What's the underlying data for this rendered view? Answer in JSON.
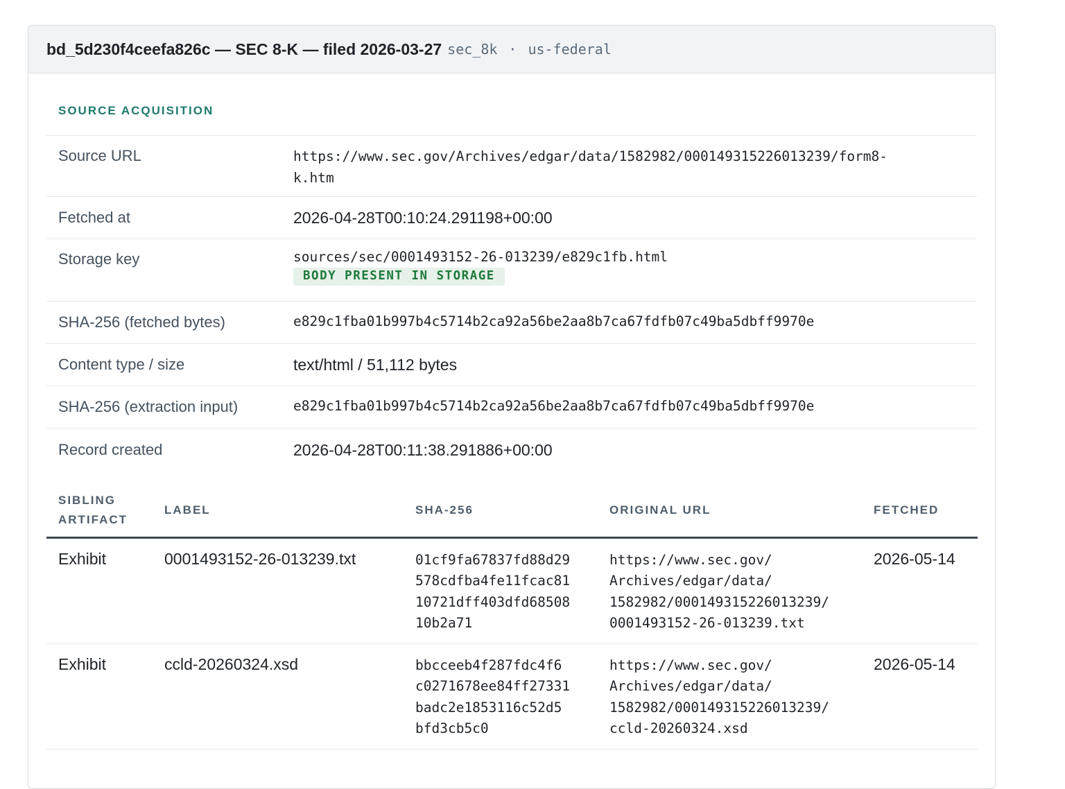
{
  "header": {
    "title": "bd_5d230f4ceefa826c — SEC 8-K — filed 2026-03-27",
    "tag1": "sec_8k",
    "separator": "·",
    "tag2": "us-federal"
  },
  "source": {
    "section_title": "SOURCE ACQUISITION",
    "rows": [
      {
        "label": "Source URL",
        "value_line1": "https://www.sec.gov/Archives/edgar/data/1582982/000149315226013239/form8-",
        "value_line2": "k.htm"
      },
      {
        "label": "Fetched at",
        "value": "2026-04-28T00:10:24.291198+00:00"
      },
      {
        "label": "Storage key",
        "value": "sources/sec/0001493152-26-013239/e829c1fb.html",
        "badge": "BODY PRESENT IN STORAGE"
      },
      {
        "label": "SHA-256 (fetched bytes)",
        "value": "e829c1fba01b997b4c5714b2ca92a56be2aa8b7ca67fdfb07c49ba5dbff9970e"
      },
      {
        "label": "Content type / size",
        "value": "text/html / 51,112 bytes"
      },
      {
        "label": "SHA-256 (extraction input)",
        "value": "e829c1fba01b997b4c5714b2ca92a56be2aa8b7ca67fdfb07c49ba5dbff9970e"
      },
      {
        "label": "Record created",
        "value": "2026-04-28T00:11:38.291886+00:00"
      }
    ]
  },
  "siblings": {
    "columns": {
      "artifact_line1": "SIBLING",
      "artifact_line2": "ARTIFACT",
      "label": "LABEL",
      "sha": "SHA-256",
      "url": "ORIGINAL URL",
      "fetched": "FETCHED"
    },
    "rows": [
      {
        "artifact": "Exhibit",
        "label": "0001493152-26-013239.txt",
        "sha": [
          "01cf9fa67837fd88d29",
          "578cdfba4fe11fcac81",
          "10721dff403dfd68508",
          "10b2a71"
        ],
        "url": [
          "https://www.sec.gov/",
          "Archives/edgar/data/",
          "1582982/000149315226013239/",
          "0001493152-26-013239.txt"
        ],
        "fetched": "2026-05-14"
      },
      {
        "artifact": "Exhibit",
        "label": "ccld-20260324.xsd",
        "sha": [
          "bbcceeb4f287fdc4f6",
          "c0271678ee84ff27331",
          "badc2e1853116c52d5",
          "bfd3cb5c0"
        ],
        "url": [
          "https://www.sec.gov/",
          "Archives/edgar/data/",
          "1582982/000149315226013239/",
          "ccld-20260324.xsd"
        ],
        "fetched": "2026-05-14"
      }
    ]
  }
}
